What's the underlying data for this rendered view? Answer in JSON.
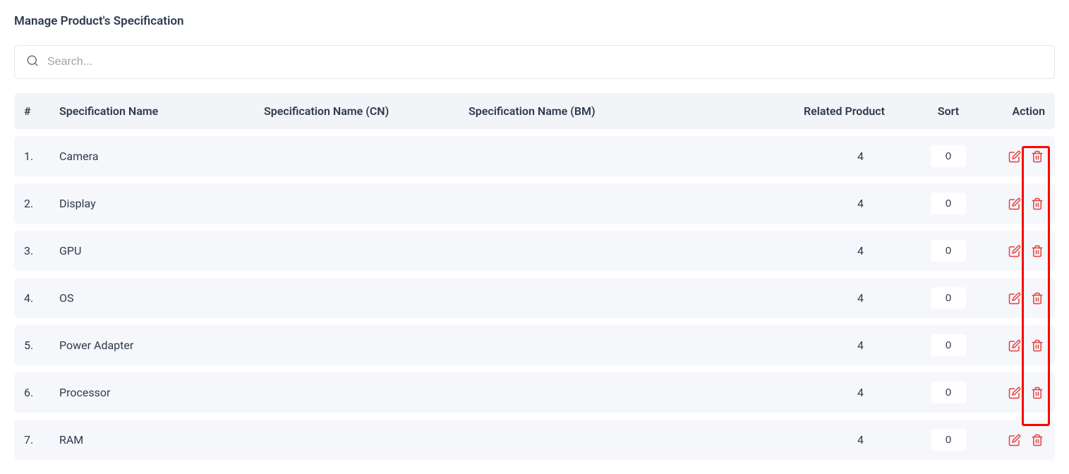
{
  "page_title": "Manage Product's Specification",
  "search": {
    "placeholder": "Search..."
  },
  "table": {
    "headers": {
      "num": "#",
      "name": "Specification Name",
      "name_cn": "Specification Name (CN)",
      "name_bm": "Specification Name (BM)",
      "related": "Related Product",
      "sort": "Sort",
      "action": "Action"
    },
    "rows": [
      {
        "num": "1.",
        "name": "Camera",
        "name_cn": "",
        "name_bm": "",
        "related": "4",
        "sort": "0"
      },
      {
        "num": "2.",
        "name": "Display",
        "name_cn": "",
        "name_bm": "",
        "related": "4",
        "sort": "0"
      },
      {
        "num": "3.",
        "name": "GPU",
        "name_cn": "",
        "name_bm": "",
        "related": "4",
        "sort": "0"
      },
      {
        "num": "4.",
        "name": "OS",
        "name_cn": "",
        "name_bm": "",
        "related": "4",
        "sort": "0"
      },
      {
        "num": "5.",
        "name": "Power Adapter",
        "name_cn": "",
        "name_bm": "",
        "related": "4",
        "sort": "0"
      },
      {
        "num": "6.",
        "name": "Processor",
        "name_cn": "",
        "name_bm": "",
        "related": "4",
        "sort": "0"
      },
      {
        "num": "7.",
        "name": "RAM",
        "name_cn": "",
        "name_bm": "",
        "related": "4",
        "sort": "0"
      }
    ]
  }
}
